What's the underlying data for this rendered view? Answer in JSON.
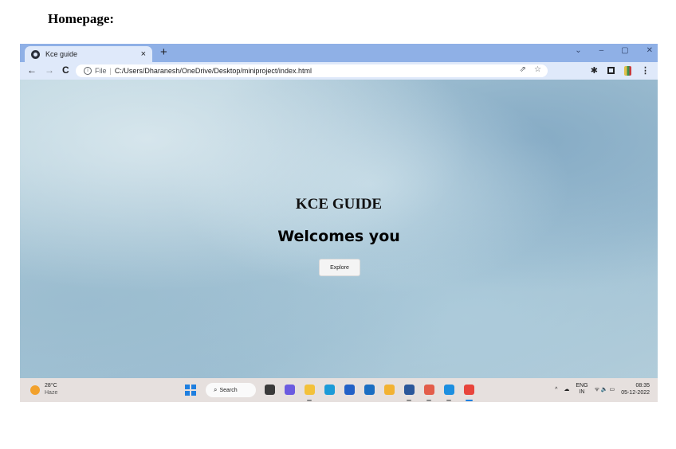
{
  "document": {
    "heading": "Homepage:"
  },
  "browser": {
    "tab": {
      "title": "Kce guide",
      "close": "×"
    },
    "new_tab": "+",
    "window_controls": {
      "dropdown": "⌄",
      "minimize": "–",
      "restore": "▢",
      "close": "✕"
    },
    "nav": {
      "back": "←",
      "forward": "→",
      "reload": "C"
    },
    "address": {
      "info": "i",
      "scheme": "File",
      "separator": "|",
      "url": "C:/Users/Dharanesh/OneDrive/Desktop/miniproject/index.html"
    },
    "actions": {
      "share": "⇗",
      "bookmark": "☆",
      "extensions": "✱",
      "menu": "⋮"
    }
  },
  "page": {
    "title": "KCE GUIDE",
    "subtitle": "Welcomes you",
    "explore_label": "Explore"
  },
  "taskbar": {
    "weather": {
      "temp": "28°C",
      "condition": "Haze"
    },
    "search_label": "Search",
    "search_icon": "⌕",
    "apps": [
      {
        "name": "task-view-icon",
        "color": "#3a3a3a"
      },
      {
        "name": "chat-icon",
        "color": "#6b5be0"
      },
      {
        "name": "file-explorer-icon",
        "color": "#f3c13a"
      },
      {
        "name": "edge-icon",
        "color": "#1c9bd8"
      },
      {
        "name": "store-icon",
        "color": "#2261c7"
      },
      {
        "name": "outlook-icon",
        "color": "#1b6ec2"
      },
      {
        "name": "chrome-canary-icon",
        "color": "#f2b233"
      },
      {
        "name": "word-icon",
        "color": "#2b579a"
      },
      {
        "name": "chrome-dev-icon",
        "color": "#e35d4a"
      },
      {
        "name": "vscode-icon",
        "color": "#1d8fe0"
      },
      {
        "name": "chrome-icon",
        "color": "#e8453c"
      }
    ],
    "tray": {
      "chevron": "^",
      "lang_line1": "ENG",
      "lang_line2": "IN",
      "status_icons": "ᯤ 🔈 ▭",
      "time": "08:35",
      "date": "05-12-2022"
    }
  }
}
